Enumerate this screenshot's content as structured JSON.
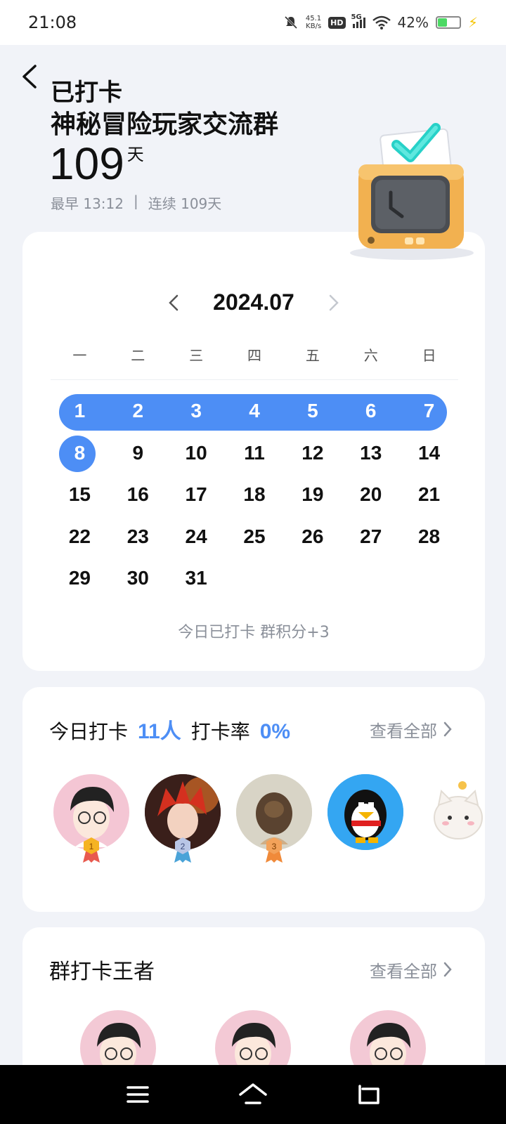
{
  "status_bar": {
    "time": "21:08",
    "net_speed_value": "45.1",
    "net_speed_unit": "KB/s",
    "hd": "HD",
    "network": "5G",
    "battery_pct": "42%",
    "battery_level": 0.42
  },
  "header": {
    "title_line1": "已打卡",
    "title_line2": "神秘冒险玩家交流群",
    "days_count": "109",
    "days_unit": "天",
    "earliest": "最早 13:12",
    "separator": "|",
    "streak": "连续 109天"
  },
  "calendar": {
    "month": "2024.07",
    "weekdays": [
      "一",
      "二",
      "三",
      "四",
      "五",
      "六",
      "日"
    ],
    "days": [
      "1",
      "2",
      "3",
      "4",
      "5",
      "6",
      "7",
      "8",
      "9",
      "10",
      "11",
      "12",
      "13",
      "14",
      "15",
      "16",
      "17",
      "18",
      "19",
      "20",
      "21",
      "22",
      "23",
      "24",
      "25",
      "26",
      "27",
      "28",
      "29",
      "30",
      "31"
    ],
    "checked_days": [
      "1",
      "2",
      "3",
      "4",
      "5",
      "6",
      "7"
    ],
    "today": "8",
    "note": "今日已打卡   群积分+3"
  },
  "today_section": {
    "label_checkin": "今日打卡",
    "count": "11人",
    "label_rate": "打卡率",
    "rate": "0%",
    "see_all": "查看全部",
    "ranks": [
      "1",
      "2",
      "3"
    ]
  },
  "king_section": {
    "title": "群打卡王者",
    "see_all": "查看全部"
  },
  "colors": {
    "accent": "#4d8ef5",
    "background": "#f1f3f8",
    "muted_text": "#8a8f99"
  },
  "icons": {
    "back": "chevron-left-icon",
    "prev_month": "chevron-left-icon",
    "next_month": "chevron-right-icon",
    "see_all": "chevron-right-icon",
    "nav_menu": "menu-icon",
    "nav_home": "home-icon",
    "nav_back": "return-icon"
  }
}
